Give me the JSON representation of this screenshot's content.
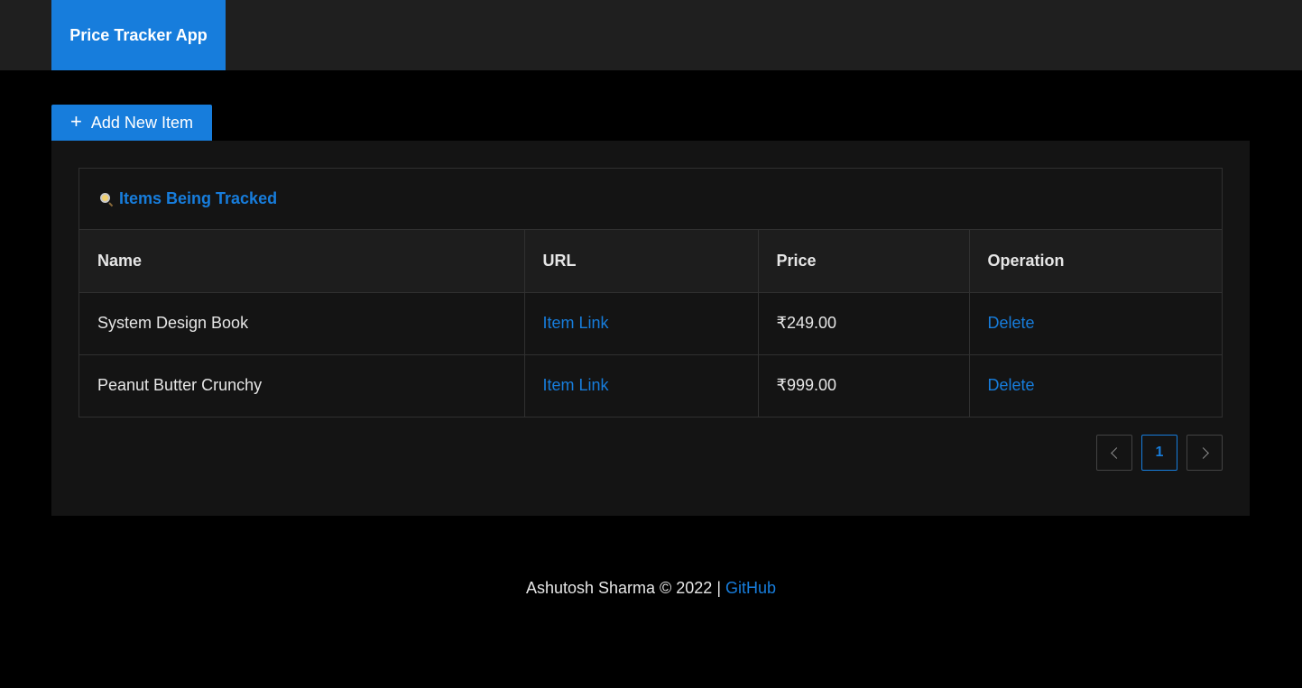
{
  "header": {
    "brand": "Price Tracker App"
  },
  "toolbar": {
    "add_label": "Add New Item"
  },
  "card": {
    "title": "Items Being Tracked"
  },
  "table": {
    "columns": [
      "Name",
      "URL",
      "Price",
      "Operation"
    ],
    "rows": [
      {
        "name": "System Design Book",
        "url": "Item Link",
        "price": "₹249.00",
        "operation": "Delete"
      },
      {
        "name": "Peanut Butter Crunchy",
        "url": "Item Link",
        "price": "₹999.00",
        "operation": "Delete"
      }
    ]
  },
  "pagination": {
    "current_page": "1"
  },
  "footer": {
    "text": "Ashutosh Sharma © 2022 |",
    "link": "GitHub"
  },
  "colors": {
    "accent": "#177ddc",
    "background": "#000000",
    "panel": "#141414",
    "header": "#1f1f1f"
  }
}
